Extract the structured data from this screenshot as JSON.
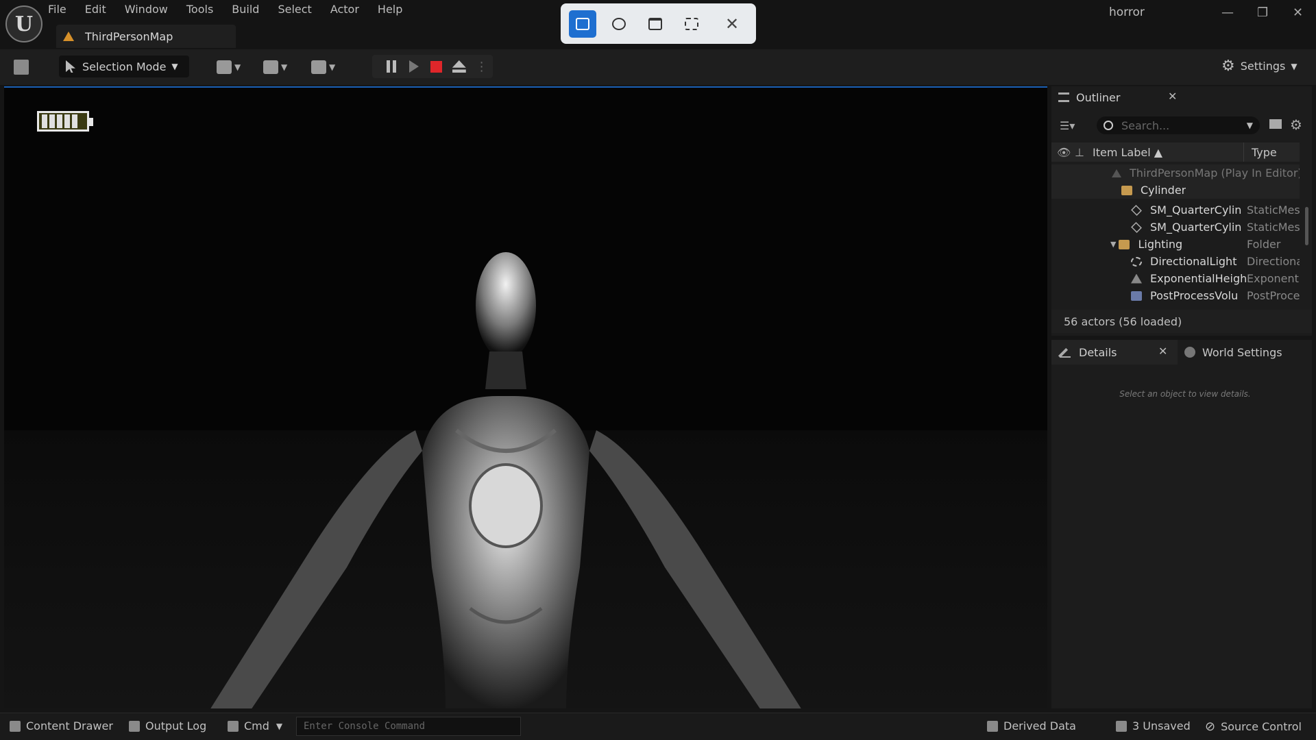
{
  "app": {
    "logo": "U",
    "project_name": "horror",
    "map_tab": "ThirdPersonMap"
  },
  "menu": [
    "File",
    "Edit",
    "Window",
    "Tools",
    "Build",
    "Select",
    "Actor",
    "Help"
  ],
  "toolbar": {
    "selection_mode": "Selection Mode",
    "settings": "Settings"
  },
  "outliner": {
    "title": "Outliner",
    "search_placeholder": "Search...",
    "col_label": "Item Label ▲",
    "col_type": "Type",
    "rows": [
      {
        "label": "ThirdPersonMap (Play In Editor)",
        "type": ""
      },
      {
        "label": "Cylinder",
        "type": ""
      },
      {
        "label": "SM_QuarterCylin",
        "type": "StaticMes"
      },
      {
        "label": "SM_QuarterCylin",
        "type": "StaticMes"
      },
      {
        "label": "Lighting",
        "type": "Folder"
      },
      {
        "label": "DirectionalLight",
        "type": "Directiona"
      },
      {
        "label": "ExponentialHeigh",
        "type": "Exponenti"
      },
      {
        "label": "PostProcessVolu",
        "type": "PostProce"
      }
    ],
    "count": "56 actors (56 loaded)"
  },
  "details": {
    "title": "Details",
    "world_settings": "World Settings",
    "empty_hint": "Select an object to view details."
  },
  "statusbar": {
    "content_drawer": "Content Drawer",
    "output_log": "Output Log",
    "cmd": "Cmd",
    "console_placeholder": "Enter Console Command",
    "derived_data": "Derived Data",
    "unsaved": "3 Unsaved",
    "source_control": "Source Control"
  },
  "hud": {
    "battery_cells": 5
  },
  "colors": {
    "accent": "#1e6fd0",
    "stop": "#e0262a",
    "folder": "#c69a4f",
    "map_icon": "#d6902a"
  }
}
